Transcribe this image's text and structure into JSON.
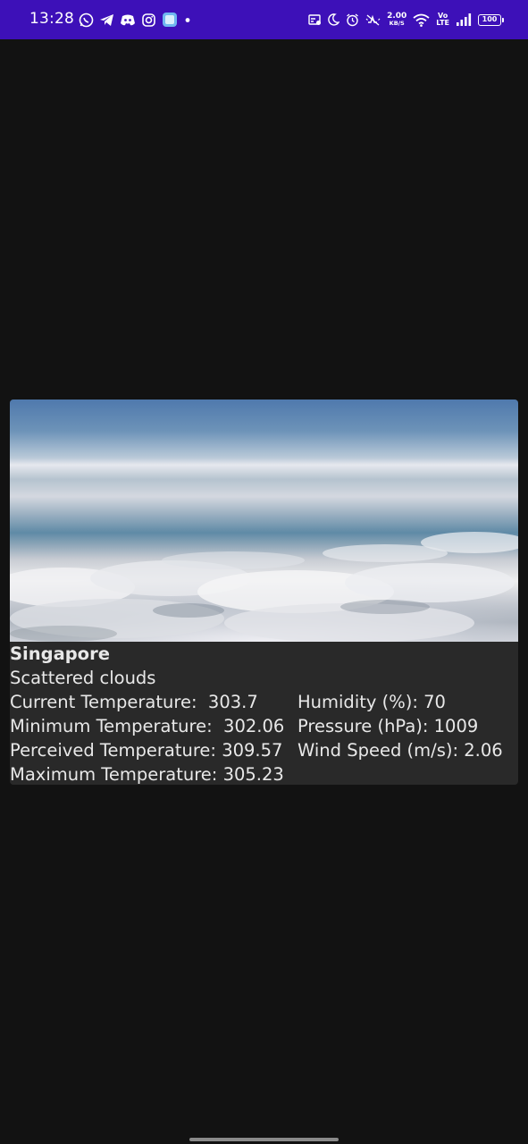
{
  "status_bar": {
    "time": "13:28",
    "net_speed_value": "2.00",
    "net_speed_unit": "KB/S",
    "volte_top": "Vo",
    "volte_bottom": "LTE",
    "battery": "100",
    "bar_color": "#3d10b8",
    "left_icons": [
      "whatsapp-icon",
      "telegram-icon",
      "discord-icon",
      "instagram-icon",
      "app-icon",
      "dot-icon"
    ],
    "right_icons": [
      "card-icon",
      "moon-icon",
      "alarm-icon",
      "mute-icon",
      "wifi-icon",
      "signal-icon",
      "battery-icon"
    ]
  },
  "weather": {
    "city": "Singapore",
    "description": "Scattered clouds",
    "current_temperature_label": "Current Temperature:  303.7",
    "minimum_temperature_label": "Minimum Temperature:  302.06",
    "perceived_temperature_label": "Perceived Temperature: 309.57",
    "maximum_temperature_label": "Maximum Temperature: 305.23",
    "humidity_label": "Humidity (%): 70",
    "pressure_label": "Pressure (hPa): 1009",
    "wind_speed_label": "Wind Speed (m/s): 2.06",
    "image_subject": "clouds-above-horizon"
  },
  "theme": {
    "background": "#121212",
    "card_background": "#292929",
    "text_color": "#e8e8e8"
  }
}
